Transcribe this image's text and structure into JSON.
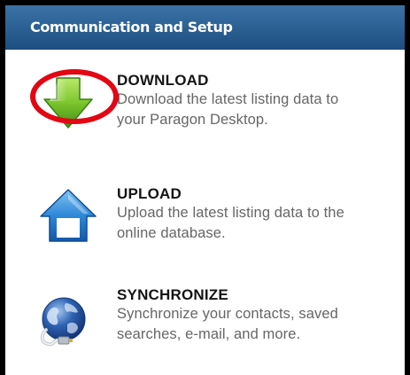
{
  "panel": {
    "title": "Communication and Setup",
    "highlight_color": "#e30613",
    "header_color": "#2b5f92",
    "items": [
      {
        "title": "DOWNLOAD",
        "description_line1": "Download the latest listing data to",
        "description_line2": "your Paragon Desktop.",
        "icon": "download-arrow-icon"
      },
      {
        "title": "UPLOAD",
        "description_line1": "Upload the latest listing data to the",
        "description_line2": "online database.",
        "icon": "upload-house-icon"
      },
      {
        "title": "SYNCHRONIZE",
        "description_line1": "Synchronize your contacts, saved",
        "description_line2": "searches, e-mail, and more.",
        "icon": "globe-cable-icon"
      }
    ]
  }
}
